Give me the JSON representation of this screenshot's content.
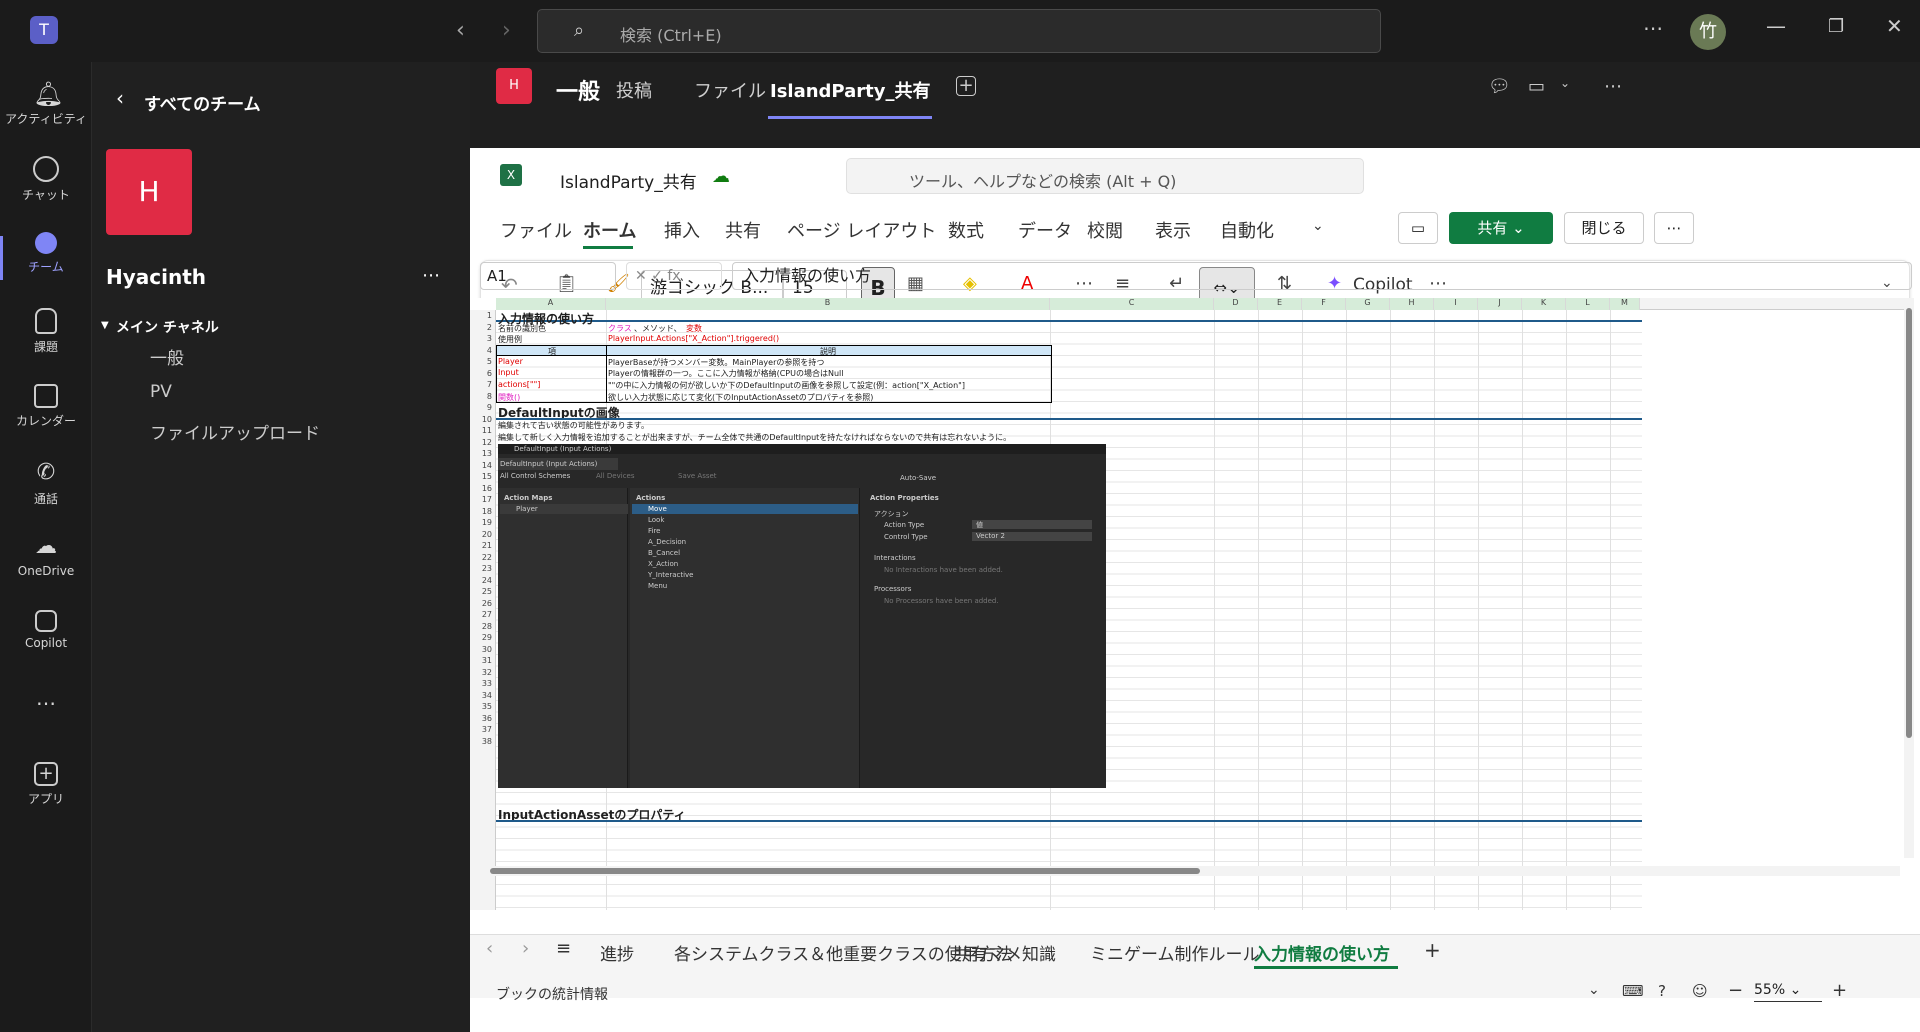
{
  "titlebar": {
    "search_placeholder": "検索 (Ctrl+E)",
    "avatar_text": "竹"
  },
  "rail": [
    {
      "label": "アクティビティ",
      "icon": "bell-icon"
    },
    {
      "label": "チャット",
      "icon": "chat-icon"
    },
    {
      "label": "チーム",
      "icon": "teams-icon"
    },
    {
      "label": "課題",
      "icon": "backpack-icon"
    },
    {
      "label": "カレンダー",
      "icon": "calendar-icon"
    },
    {
      "label": "通話",
      "icon": "phone-icon"
    },
    {
      "label": "OneDrive",
      "icon": "cloud-icon"
    },
    {
      "label": "Copilot",
      "icon": "copilot-icon"
    },
    {
      "label": "…",
      "icon": "more-icon"
    },
    {
      "label": "アプリ",
      "icon": "add-app-icon"
    }
  ],
  "teams_panel": {
    "back_label": "すべてのチーム",
    "team_initial": "H",
    "team_name": "Hyacinth",
    "section": "メイン チャネル",
    "channels": [
      "一般",
      "PV",
      "ファイルアップロード"
    ]
  },
  "channel_header": {
    "avatar": "H",
    "name": "一般",
    "tabs": [
      "投稿",
      "ファイル",
      "IslandParty_共有"
    ]
  },
  "excel": {
    "file_name": "IslandParty_共有",
    "search_placeholder": "ツール、ヘルプなどの検索 (Alt + Q)",
    "ribbon_tabs": [
      "ファイル",
      "ホーム",
      "挿入",
      "共有",
      "ページ レイアウト",
      "数式",
      "データ",
      "校閲",
      "表示",
      "自動化"
    ],
    "share_label": "共有",
    "close_label": "閉じる",
    "font_name": "游ゴシック B...",
    "font_size": "15",
    "copilot_label": "Copilot",
    "name_box": "A1",
    "formula": "入力情報の使い方",
    "columns": [
      "A",
      "B",
      "C",
      "D",
      "E",
      "F",
      "G",
      "H",
      "I",
      "J",
      "K",
      "L",
      "M"
    ],
    "cells": {
      "title": "入力情報の使い方",
      "r2a": "名前の識別色",
      "r2b1": "クラス",
      "r2b2": "、メソッド、",
      "r2b3": "変数",
      "r3a": "使用例",
      "r3b": "PlayerInput.Actions[\"X_Action\"].triggered()",
      "h_item": "項",
      "h_desc": "説明",
      "r5a": "Player",
      "r5b": "PlayerBaseが持つメンバー変数。MainPlayerの参照を持つ",
      "r6a": "Input",
      "r6b": "Playerの情報群の一つ。ここに入力情報が格納(CPUの場合はNull",
      "r7a": "actions[\"\"]",
      "r7b": "\"\"の中に入力情報の何が欲しいか下のDefaultInputの画像を参照して設定(例：action[\"X_Action\"]",
      "r8a": "関数()",
      "r8b": "欲しい入力状態に応じて変化(下のInputActionAssetのプロパティを参照)",
      "r9": "DefaultInputの画像",
      "r10": "編集されて古い状態の可能性があります。",
      "r11": "編集して新しく入力情報を追加することが出来ますが、チーム全体で共通のDefaultInputを持たなければならないので共有は忘れないように。",
      "r37": "InputActionAssetのプロパティ"
    },
    "unity": {
      "title": "DefaultInput (Input Actions)",
      "tab": "DefaultInput (Input Actions)",
      "schemes": "All Control Schemes",
      "devices": "All Devices",
      "save": "Save Asset",
      "autosave": "Auto-Save",
      "maps_h": "Action Maps",
      "map": "Player",
      "actions_h": "Actions",
      "actions": [
        "Move",
        "Look",
        "Fire",
        "A_Decision",
        "B_Cancel",
        "X_Action",
        "Y_Interactive",
        "Menu"
      ],
      "props_h": "Action Properties",
      "action": "アクション",
      "type_l": "Action Type",
      "type_v": "値",
      "ctrl_l": "Control Type",
      "ctrl_v": "Vector 2",
      "inter": "Interactions",
      "inter_e": "No Interactions have been added.",
      "proc": "Processors",
      "proc_e": "No Processors have been added."
    },
    "sheets": [
      "進捗",
      "各システムクラス＆他重要クラスの使用方法",
      "共有マメ知識",
      "ミニゲーム制作ルール",
      "入力情報の使い方"
    ],
    "status": "ブックの統計情報",
    "zoom": "55%"
  }
}
